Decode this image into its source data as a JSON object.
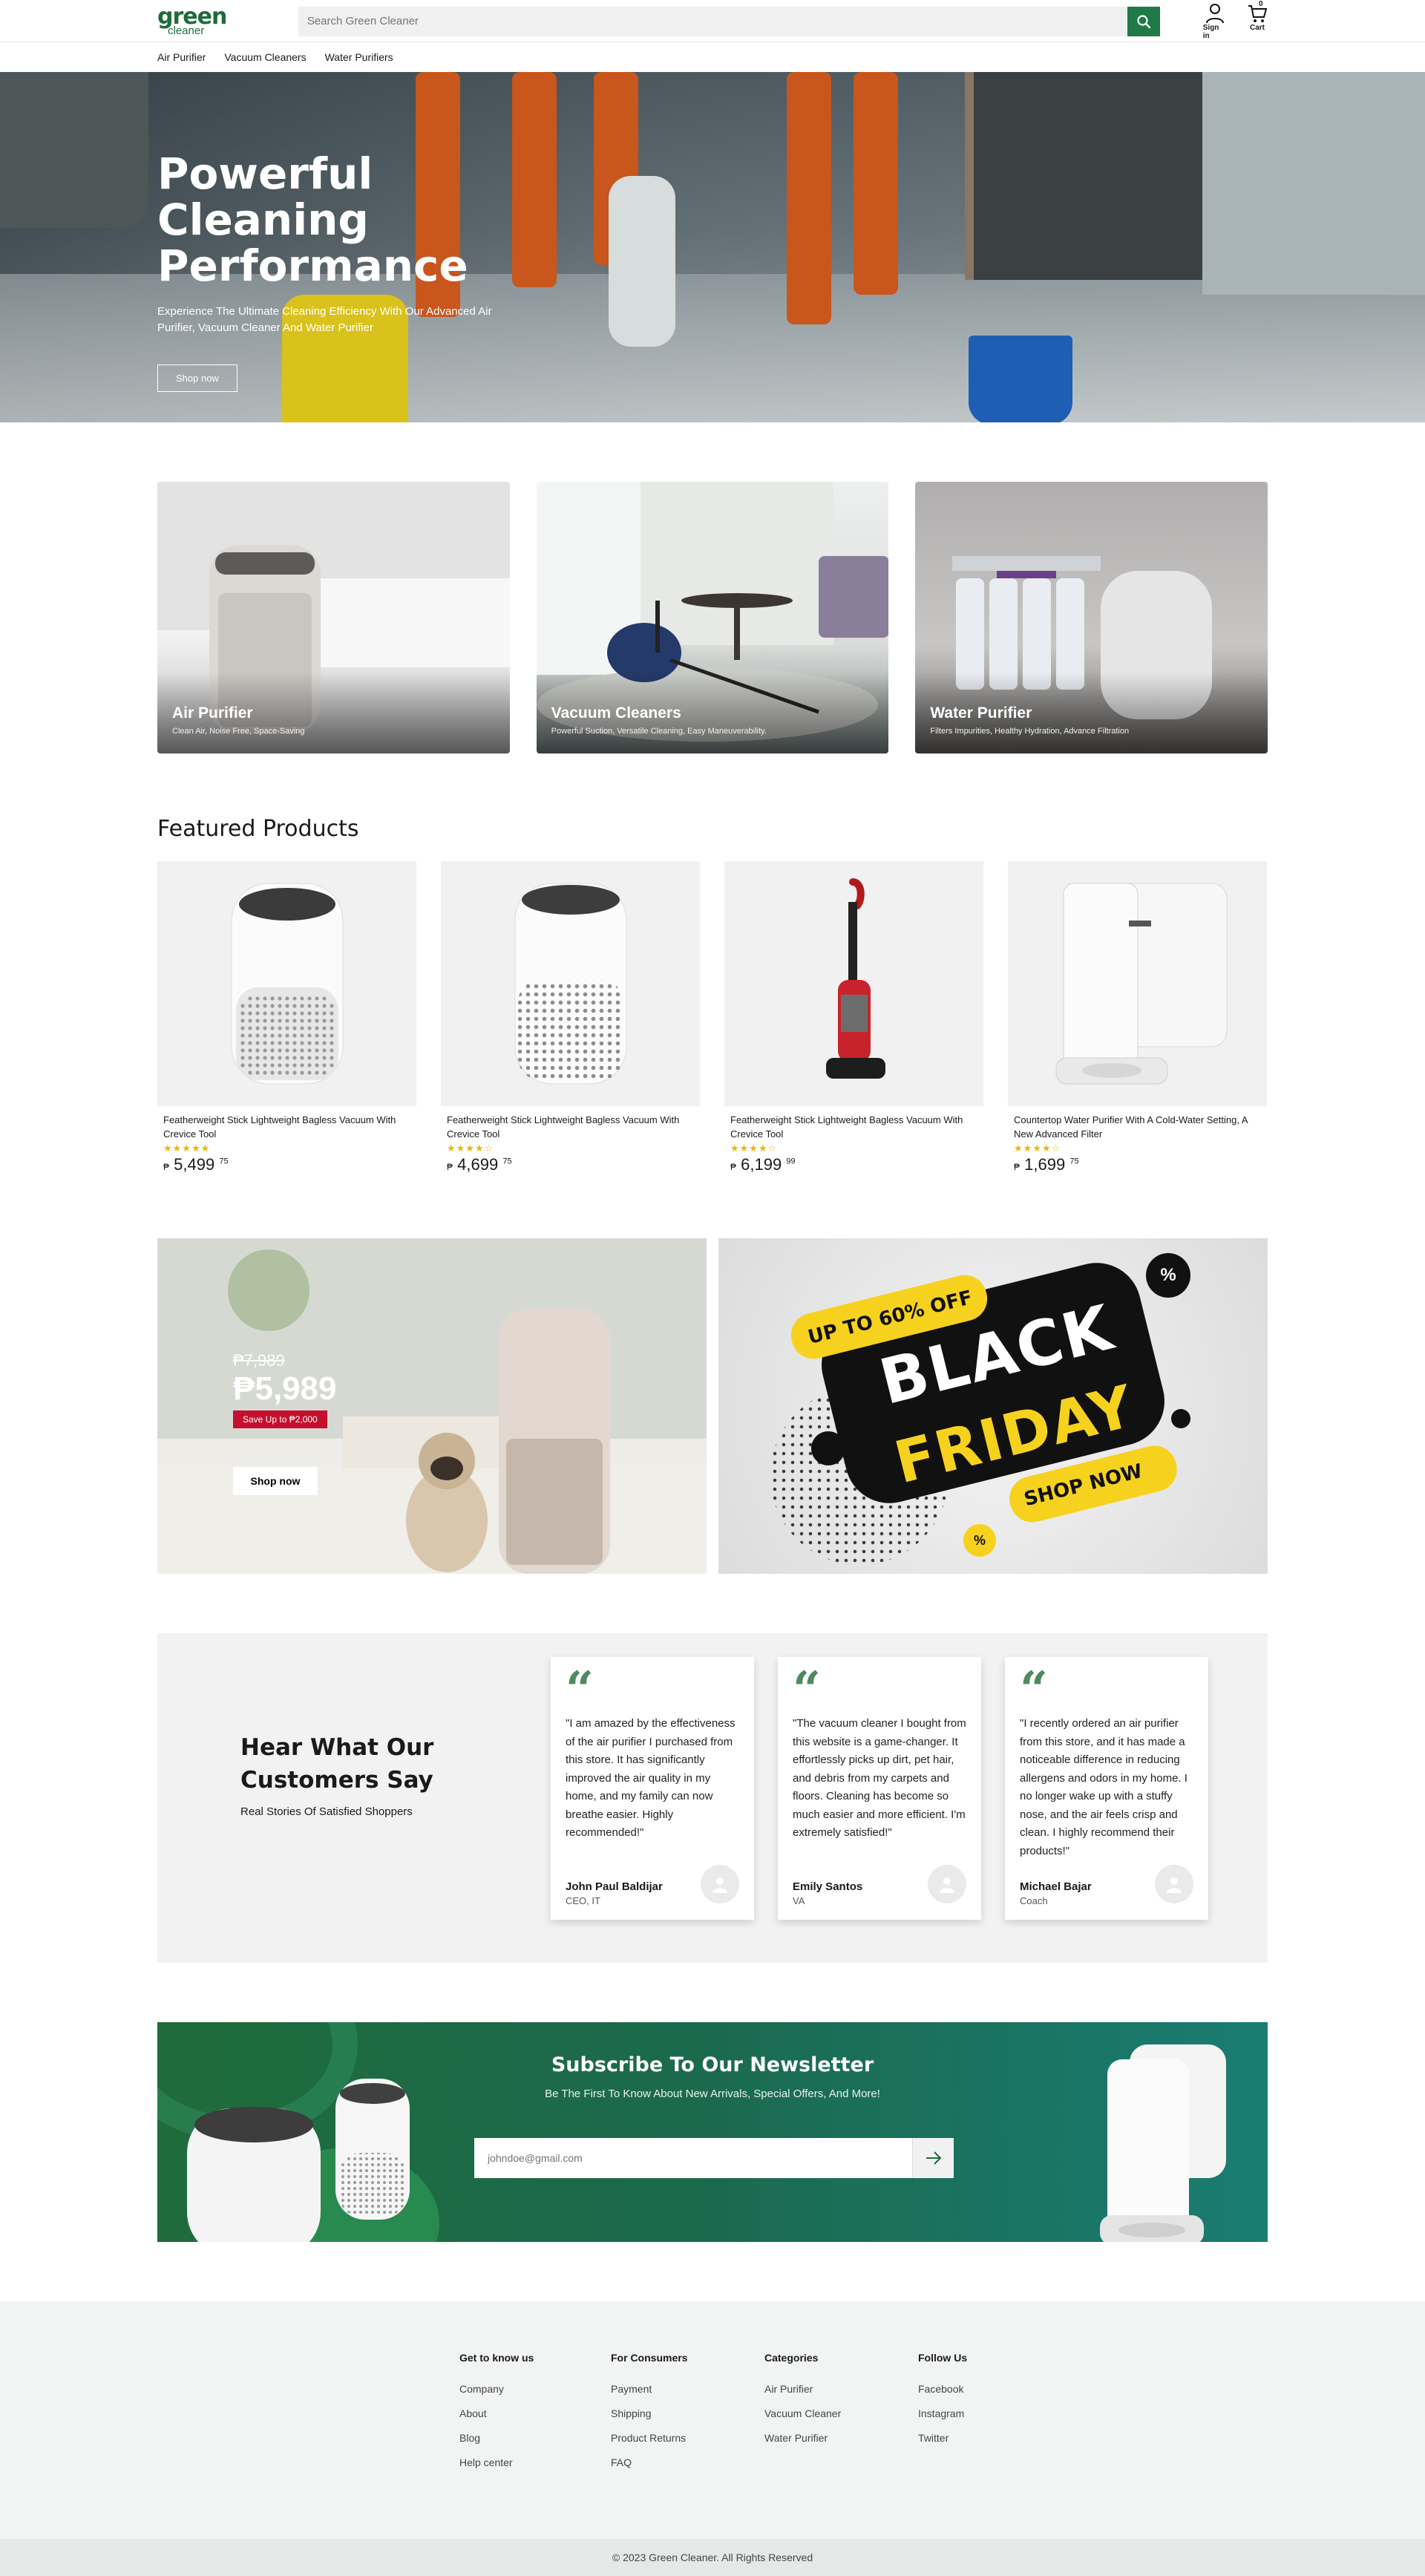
{
  "header": {
    "logo_top": "green",
    "logo_bottom": "cleaner",
    "search_placeholder": "Search Green Cleaner",
    "signin_label": "Sign in",
    "cart_label": "Cart",
    "cart_count": "0"
  },
  "nav": {
    "items": [
      "Air Purifier",
      "Vacuum Cleaners",
      "Water Purifiers"
    ]
  },
  "hero": {
    "title": "Powerful Cleaning Performance",
    "subtitle": "Experience The Ultimate Cleaning Efficiency With Our Advanced Air Purifier, Vacuum Cleaner And Water Purifier",
    "cta": "Shop now"
  },
  "categories": [
    {
      "title": "Air Purifier",
      "desc": "Clean Air, Noise Free, Space-Saving"
    },
    {
      "title": "Vacuum Cleaners",
      "desc": "Powerful Suction, Versatile Cleaning, Easy Maneuverability."
    },
    {
      "title": "Water Purifier",
      "desc": "Filters Impurities, Healthy Hydration, Advance Filtration"
    }
  ],
  "featured": {
    "title": "Featured Products",
    "products": [
      {
        "name": "Featherweight Stick Lightweight Bagless Vacuum With Crevice Tool",
        "stars": "★★★★★",
        "rating": 5,
        "currency": "₱",
        "price": "5,499",
        "cents": "75"
      },
      {
        "name": "Featherweight Stick Lightweight Bagless Vacuum With Crevice Tool",
        "stars": "★★★★☆",
        "rating": 4,
        "currency": "₱",
        "price": "4,699",
        "cents": "75"
      },
      {
        "name": "Featherweight Stick Lightweight Bagless Vacuum With Crevice Tool",
        "stars": "★★★★☆",
        "rating": 4,
        "currency": "₱",
        "price": "6,199",
        "cents": "99"
      },
      {
        "name": "Countertop Water Purifier With A Cold-Water Setting, A New Advanced Filter",
        "stars": "★★★★☆",
        "rating": 4,
        "currency": "₱",
        "price": "1,699",
        "cents": "75"
      }
    ]
  },
  "promo": {
    "old_price": "₱7,989",
    "new_price": "₱5,989",
    "save": "Save Up to ₱2,000",
    "cta": "Shop now",
    "bf_off": "UP TO 60% OFF",
    "bf_black": "BLACK",
    "bf_friday": "FRIDAY",
    "bf_shop": "SHOP NOW",
    "bf_pct": "%"
  },
  "testimonials": {
    "title": "Hear What Our Customers Say",
    "subtitle": "Real Stories Of Satisfied Shoppers",
    "items": [
      {
        "text": "\"I am amazed by the effectiveness of the air purifier I purchased from this store. It has significantly improved the air quality in my home, and my family can now breathe easier. Highly recommended!\"",
        "name": "John Paul Baldijar",
        "role": "CEO, IT"
      },
      {
        "text": "\"The vacuum cleaner I bought from this website is a game-changer. It effortlessly picks up dirt, pet hair, and debris from my carpets and floors. Cleaning has become so much easier and more efficient. I'm extremely satisfied!\"",
        "name": "Emily Santos",
        "role": "VA"
      },
      {
        "text": "\"I recently ordered an air purifier from this store, and it has made a noticeable difference in reducing allergens and odors in my home. I no longer wake up with a stuffy nose, and the air feels crisp and clean. I highly recommend their products!\"",
        "name": "Michael Bajar",
        "role": "Coach"
      }
    ]
  },
  "newsletter": {
    "title": "Subscribe To Our Newsletter",
    "subtitle": "Be The First To Know About New Arrivals, Special Offers, And More!",
    "placeholder": "johndoe@gmail.com"
  },
  "footer": {
    "columns": [
      {
        "title": "Get to know us",
        "links": [
          "Company",
          "About",
          "Blog",
          "Help center"
        ]
      },
      {
        "title": "For Consumers",
        "links": [
          "Payment",
          "Shipping",
          "Product Returns",
          "FAQ"
        ]
      },
      {
        "title": "Categories",
        "links": [
          "Air Purifier",
          "Vacuum Cleaner",
          "Water Purifier"
        ]
      },
      {
        "title": "Follow Us",
        "links": [
          "Facebook",
          "Instagram",
          "Twitter"
        ]
      }
    ],
    "copyright": "© 2023 Green Cleaner.  All Rights Reserved"
  },
  "colors": {
    "brand_green": "#1f7a47",
    "sale_red": "#c4102e",
    "star_yellow": "#f0b400",
    "bf_yellow": "#f6d21e"
  },
  "icons": [
    "search-icon",
    "user-icon",
    "cart-icon",
    "arrow-right-icon",
    "quote-icon",
    "avatar-icon"
  ]
}
